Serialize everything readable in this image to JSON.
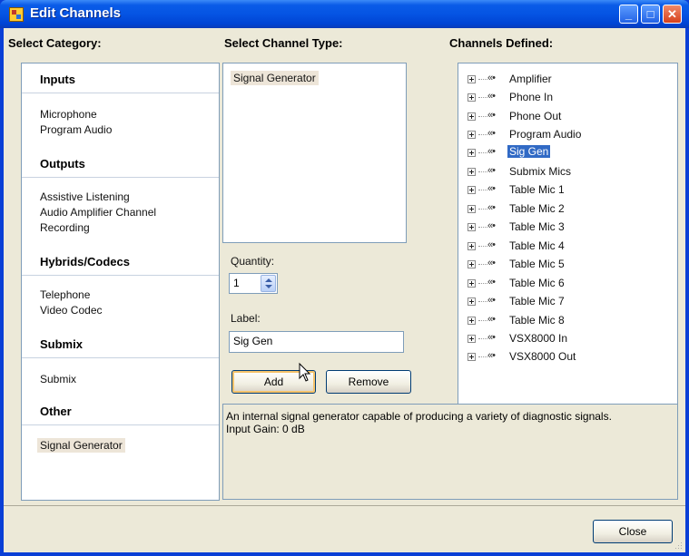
{
  "window": {
    "title": "Edit Channels",
    "minimize": "_",
    "maximize": "□",
    "close": "✕"
  },
  "headers": {
    "category": "Select Category:",
    "channel_type": "Select Channel Type:",
    "defined": "Channels Defined:"
  },
  "categories": [
    {
      "heading": "Inputs",
      "items": [
        "Microphone",
        "Program Audio"
      ]
    },
    {
      "heading": "Outputs",
      "items": [
        "Assistive Listening",
        "Audio Amplifier Channel",
        "Recording"
      ]
    },
    {
      "heading": "Hybrids/Codecs",
      "items": [
        "Telephone",
        "Video Codec"
      ]
    },
    {
      "heading": "Submix",
      "items": [
        "Submix"
      ]
    },
    {
      "heading": "Other",
      "items": [
        "Signal Generator"
      ]
    }
  ],
  "selected_category": "Signal Generator",
  "channel_types": [
    "Signal Generator"
  ],
  "quantity": {
    "label": "Quantity:",
    "value": "1"
  },
  "label_field": {
    "label": "Label:",
    "value": "Sig Gen"
  },
  "buttons": {
    "add": "Add",
    "remove": "Remove",
    "close": "Close"
  },
  "channels_defined": [
    "Amplifier",
    "Phone In",
    "Phone Out",
    "Program Audio",
    "Sig Gen",
    "Submix Mics",
    "Table Mic 1",
    "Table Mic 2",
    "Table Mic 3",
    "Table Mic 4",
    "Table Mic 5",
    "Table Mic 6",
    "Table Mic 7",
    "Table Mic 8",
    "VSX8000 In",
    "VSX8000 Out"
  ],
  "selected_channel": "Sig Gen",
  "description": {
    "line1": "An internal signal generator capable of producing a variety of diagnostic signals.",
    "line2": "Input Gain: 0 dB"
  },
  "icons": {
    "tree_expand": "plus-box-icon",
    "channel": "speaker-icon",
    "app": "app-icon"
  },
  "colors": {
    "title_bar": "#0a5ce8",
    "selection": "#316ac5",
    "dialog_bg": "#ece9d8"
  }
}
